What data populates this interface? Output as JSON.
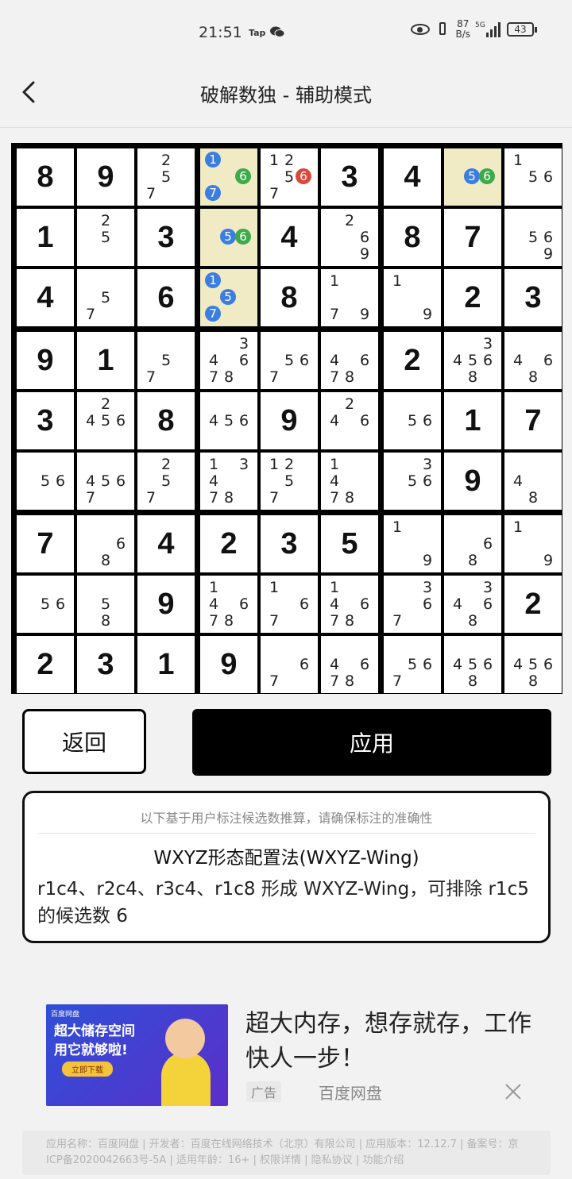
{
  "status_bar": {
    "time": "21:51",
    "tap_label": "Tap",
    "speed_value": "87",
    "speed_unit": "B/s",
    "network": "5G",
    "battery": "43"
  },
  "header": {
    "title": "破解数独 - 辅助模式",
    "back_icon": "chevron-left-icon"
  },
  "colors": {
    "highlight": "#f0ebc5",
    "blue": "#3b7de0",
    "green": "#3dab4a",
    "red": "#d94a3d"
  },
  "board": {
    "rows": [
      [
        {
          "v": 8
        },
        {
          "v": 9
        },
        {
          "c": [
            2,
            5,
            7
          ]
        },
        {
          "hl": true,
          "c": [
            1,
            6,
            7
          ],
          "m": {
            "1": "blue",
            "6": "green",
            "7": "blue"
          }
        },
        {
          "c": [
            1,
            2,
            5,
            6,
            7
          ],
          "m": {
            "6": "red"
          }
        },
        {
          "v": 3
        },
        {
          "v": 4
        },
        {
          "hl": true,
          "c": [
            5,
            6
          ],
          "m": {
            "5": "blue",
            "6": "green"
          }
        },
        {
          "c": [
            1,
            5,
            6
          ]
        }
      ],
      [
        {
          "v": 1
        },
        {
          "c": [
            2,
            5
          ]
        },
        {
          "v": 3
        },
        {
          "hl": true,
          "c": [
            5,
            6
          ],
          "m": {
            "5": "blue",
            "6": "green"
          }
        },
        {
          "v": 4
        },
        {
          "c": [
            2,
            6,
            9
          ]
        },
        {
          "v": 8
        },
        {
          "v": 7
        },
        {
          "c": [
            5,
            6,
            9
          ]
        }
      ],
      [
        {
          "v": 4
        },
        {
          "c": [
            5,
            7
          ]
        },
        {
          "v": 6
        },
        {
          "hl": true,
          "c": [
            1,
            5,
            7
          ],
          "m": {
            "1": "blue",
            "5": "blue",
            "7": "blue"
          }
        },
        {
          "v": 8
        },
        {
          "c": [
            1,
            7,
            9
          ]
        },
        {
          "c": [
            1,
            9
          ]
        },
        {
          "v": 2
        },
        {
          "v": 3
        }
      ],
      [
        {
          "v": 9
        },
        {
          "v": 1
        },
        {
          "c": [
            5,
            7
          ]
        },
        {
          "c": [
            3,
            4,
            6,
            7,
            8
          ]
        },
        {
          "c": [
            5,
            6,
            7
          ]
        },
        {
          "c": [
            4,
            6,
            7,
            8
          ]
        },
        {
          "v": 2
        },
        {
          "c": [
            3,
            4,
            5,
            6,
            8
          ]
        },
        {
          "c": [
            4,
            6,
            8
          ]
        }
      ],
      [
        {
          "v": 3
        },
        {
          "c": [
            2,
            4,
            5,
            6
          ]
        },
        {
          "v": 8
        },
        {
          "c": [
            4,
            5,
            6
          ]
        },
        {
          "v": 9
        },
        {
          "c": [
            2,
            4,
            6
          ]
        },
        {
          "c": [
            5,
            6
          ]
        },
        {
          "v": 1
        },
        {
          "v": 7
        }
      ],
      [
        {
          "c": [
            5,
            6
          ]
        },
        {
          "c": [
            4,
            5,
            6,
            7
          ]
        },
        {
          "c": [
            2,
            5,
            7
          ]
        },
        {
          "c": [
            1,
            3,
            4,
            7,
            8
          ]
        },
        {
          "c": [
            1,
            2,
            5,
            7
          ]
        },
        {
          "c": [
            1,
            4,
            7,
            8
          ]
        },
        {
          "c": [
            3,
            5,
            6
          ]
        },
        {
          "v": 9
        },
        {
          "c": [
            4,
            8
          ]
        }
      ],
      [
        {
          "v": 7
        },
        {
          "c": [
            6,
            8
          ]
        },
        {
          "v": 4
        },
        {
          "v": 2
        },
        {
          "v": 3
        },
        {
          "v": 5
        },
        {
          "c": [
            1,
            9
          ]
        },
        {
          "c": [
            6,
            8
          ]
        },
        {
          "c": [
            1,
            9
          ]
        }
      ],
      [
        {
          "c": [
            5,
            6
          ]
        },
        {
          "c": [
            5,
            8
          ]
        },
        {
          "v": 9
        },
        {
          "c": [
            1,
            4,
            6,
            7,
            8
          ]
        },
        {
          "c": [
            1,
            6,
            7
          ]
        },
        {
          "c": [
            1,
            4,
            6,
            7,
            8
          ]
        },
        {
          "c": [
            3,
            6,
            7
          ]
        },
        {
          "c": [
            3,
            4,
            6,
            8
          ]
        },
        {
          "v": 2
        }
      ],
      [
        {
          "v": 2
        },
        {
          "v": 3
        },
        {
          "v": 1
        },
        {
          "v": 9
        },
        {
          "c": [
            6,
            7
          ]
        },
        {
          "c": [
            4,
            6,
            7,
            8
          ]
        },
        {
          "c": [
            5,
            6,
            7
          ]
        },
        {
          "c": [
            4,
            5,
            6,
            8
          ]
        },
        {
          "c": [
            4,
            5,
            6,
            8
          ]
        }
      ]
    ]
  },
  "actions": {
    "back_label": "返回",
    "apply_label": "应用"
  },
  "hint": {
    "note": "以下基于用户标注候选数推算，请确保标注的准确性",
    "technique": "WXYZ形态配置法(WXYZ-Wing)",
    "description": "r1c4、r2c4、r3c4、r1c8 形成 WXYZ-Wing，可排除 r1c5 的候选数 6"
  },
  "ad": {
    "image_brand": "百度网盘",
    "image_headline_1": "超大储存空间",
    "image_headline_2": "用它就够啦!",
    "image_button": "立即下载",
    "headline": "超大内存，想存就存，工作快人一步！",
    "badge": "广告",
    "source": "百度网盘",
    "close_icon": "close-icon"
  },
  "footer": {
    "text": "应用名称：百度网盘 | 开发者：百度在线网络技术（北京）有限公司 | 应用版本：12.12.7 | 备案号：京ICP备2020042663号-5A | 适用年龄：16+ | 权限详情 | 隐私协议 | 功能介绍"
  }
}
